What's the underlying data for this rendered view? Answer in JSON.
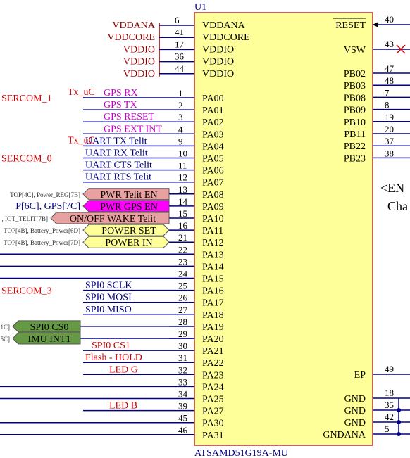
{
  "component": {
    "ref": "U1",
    "part": "ATSAMD51G19A-MU",
    "body_color": "#ffff99",
    "body_stroke": "#b03030"
  },
  "colors": {
    "wire": "#000080",
    "power_label": "#8b0000",
    "sercom": "#cc0000",
    "tx_label": "#cc0000",
    "gps_label": "#cc00cc",
    "net_label": "#000080",
    "uart_label": "#000080",
    "flash_label": "#cc0000",
    "pwr_flag_fill": "#e8a0a0",
    "gps_flag_fill": "#ff00ff",
    "power_flag_fill": "#ffff99",
    "spi_flag_fill": "#669944",
    "junction": "#000080",
    "noconnect": "#cc0000"
  },
  "power_pins": [
    {
      "net": "VDDANA",
      "num": "6",
      "name": "VDDANA"
    },
    {
      "net": "VDDCORE",
      "num": "41",
      "name": "VDDCORE"
    },
    {
      "net": "VDDIO",
      "num": "17",
      "name": "VDDIO"
    },
    {
      "net": "VDDIO",
      "num": "36",
      "name": "VDDIO"
    },
    {
      "net": "VDDIO",
      "num": "44",
      "name": "VDDIO"
    }
  ],
  "left_pins": [
    {
      "num": "1",
      "name": "PA00",
      "net": "GPS_RX",
      "net_color": "gps",
      "prefix": "Tx_uC"
    },
    {
      "num": "2",
      "name": "PA01",
      "net": "GPS_TX",
      "net_color": "gps"
    },
    {
      "num": "3",
      "name": "PA02",
      "net": "GPS_RESET",
      "net_color": "gps"
    },
    {
      "num": "4",
      "name": "PA03",
      "net": "GPS_EXT_INT",
      "net_color": "gps"
    },
    {
      "num": "9",
      "name": "PA04",
      "net": "UART_TX_Telit",
      "net_color": "uart",
      "prefix": "Tx_uC"
    },
    {
      "num": "10",
      "name": "PA05",
      "net": "UART_RX_Telit",
      "net_color": "uart"
    },
    {
      "num": "11",
      "name": "PA06",
      "net": "UART_CTS_Telit",
      "net_color": "uart"
    },
    {
      "num": "12",
      "name": "PA07",
      "net": "UART_RTS_Telit",
      "net_color": "uart"
    },
    {
      "num": "13",
      "name": "PA08",
      "flag": "PWR_Telit_EN",
      "flag_color": "pwr",
      "ref": "TOP[4C], Power_REG[7B]"
    },
    {
      "num": "14",
      "name": "PA09",
      "flag": "PWR_GPS_EN",
      "flag_color": "gps",
      "ref": "P[6C], GPS[7C]"
    },
    {
      "num": "15",
      "name": "PA10",
      "flag": "ON/OFF_WAKE_Telit",
      "flag_color": "pwr",
      "ref": ", IOT_TELIT[7B]"
    },
    {
      "num": "16",
      "name": "PA11",
      "flag": "POWER_SET",
      "flag_color": "power",
      "ref": "TOP[4B], Battery_Power[6D]"
    },
    {
      "num": "21",
      "name": "PA12",
      "flag": "POWER_IN",
      "flag_color": "power",
      "ref": "TOP[4B], Battery_Power[7D]"
    },
    {
      "num": "22",
      "name": "PA13"
    },
    {
      "num": "23",
      "name": "PA14"
    },
    {
      "num": "24",
      "name": "PA15"
    },
    {
      "num": "25",
      "name": "PA16",
      "net": "SPI0_SCLK",
      "net_color": "uart"
    },
    {
      "num": "26",
      "name": "PA17",
      "net": "SPI0_MOSI",
      "net_color": "uart"
    },
    {
      "num": "27",
      "name": "PA18",
      "net": "SPI0_MISO",
      "net_color": "uart"
    },
    {
      "num": "28",
      "name": "PA19",
      "flag": "SPI0_CS0",
      "flag_color": "spi",
      "ref": "1C]"
    },
    {
      "num": "29",
      "name": "PA20",
      "flag": "IMU_INT1",
      "flag_color": "spi",
      "ref": "5C]"
    },
    {
      "num": "30",
      "name": "PA21",
      "net": "SPI0_CS1",
      "net_color": "flash"
    },
    {
      "num": "31",
      "name": "PA22",
      "net": "Flash - HOLD",
      "net_color": "flash"
    },
    {
      "num": "32",
      "name": "PA23",
      "net": "LED_G",
      "net_color": "flash"
    },
    {
      "num": "33",
      "name": "PA24"
    },
    {
      "num": "34",
      "name": "PA25"
    },
    {
      "num": "39",
      "name": "PA27",
      "net": "LED_B",
      "net_color": "flash"
    },
    {
      "num": "45",
      "name": "PA30"
    },
    {
      "num": "46",
      "name": "PA31"
    }
  ],
  "sercom_labels": [
    {
      "text": "SERCOM_1",
      "row": 0
    },
    {
      "text": "SERCOM_0",
      "row": 5
    },
    {
      "text": "SERCOM_3",
      "row": 16
    }
  ],
  "right_pins_top": [
    {
      "num": "40",
      "name": "RESET",
      "overbar": true
    },
    {
      "num": "43",
      "name": "VSW",
      "noconnect": true
    }
  ],
  "right_pins_pb": [
    {
      "num": "47",
      "name": "PB02"
    },
    {
      "num": "48",
      "name": "PB03"
    },
    {
      "num": "7",
      "name": "PB08"
    },
    {
      "num": "8",
      "name": "PB09"
    },
    {
      "num": "19",
      "name": "PB10"
    },
    {
      "num": "20",
      "name": "PB11"
    },
    {
      "num": "37",
      "name": "PB22"
    },
    {
      "num": "38",
      "name": "PB23"
    }
  ],
  "right_pins_bottom": [
    {
      "num": "49",
      "name": "EP"
    },
    {
      "num": "18",
      "name": "GND"
    },
    {
      "num": "35",
      "name": "GND"
    },
    {
      "num": "42",
      "name": "GND"
    },
    {
      "num": "5",
      "name": "GNDANA"
    }
  ],
  "note": {
    "line1": "<EN",
    "line2": "Cha"
  }
}
